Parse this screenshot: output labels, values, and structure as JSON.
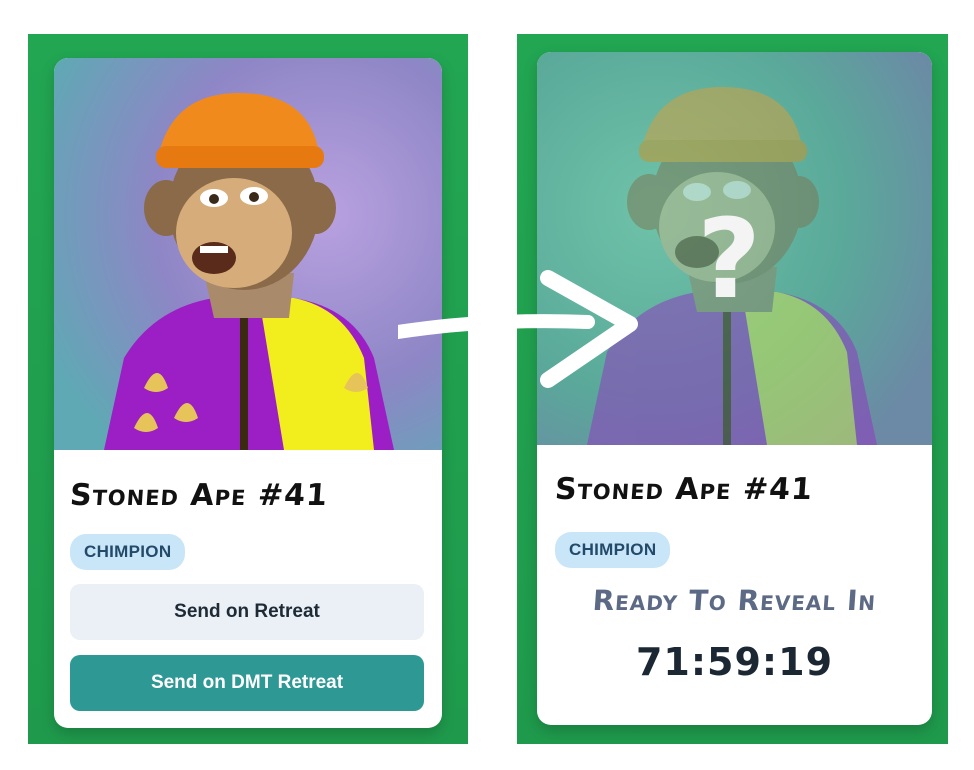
{
  "left_card": {
    "title": "Stoned Ape #41",
    "badge": "CHIMPION",
    "retreat_button": "Send on Retreat",
    "dmt_button": "Send on DMT Retreat"
  },
  "right_card": {
    "title": "Stoned Ape #41",
    "badge": "CHIMPION",
    "reveal_label": "Ready To Reveal In",
    "countdown": "71:59:19",
    "mystery_mark": "?"
  },
  "colors": {
    "panel_green": "#22a652",
    "badge_bg": "#c9e6f8",
    "badge_text": "#234a6a",
    "secondary_button": "#eaf0f5",
    "primary_button": "#2e9894",
    "reveal_text": "#5d6a86"
  }
}
